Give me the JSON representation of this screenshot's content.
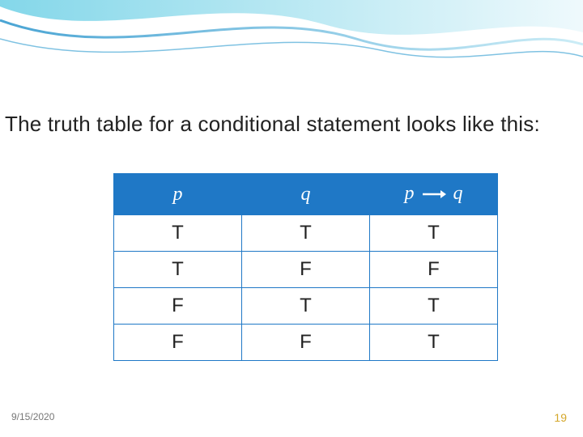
{
  "heading": "The truth table for a conditional statement looks like this:",
  "table": {
    "headers": {
      "p": "p",
      "q": "q",
      "pq_left": "p",
      "pq_right": "q"
    },
    "rows": [
      {
        "p": "T",
        "q": "T",
        "pq": "T"
      },
      {
        "p": "T",
        "q": "F",
        "pq": "F"
      },
      {
        "p": "F",
        "q": "T",
        "pq": "T"
      },
      {
        "p": "F",
        "q": "F",
        "pq": "T"
      }
    ]
  },
  "footer": {
    "date": "9/15/2020",
    "page": "19"
  },
  "colors": {
    "header_bg": "#1f78c6",
    "page_number": "#d4a72a"
  }
}
